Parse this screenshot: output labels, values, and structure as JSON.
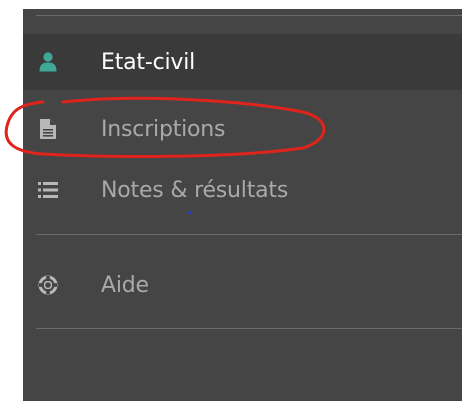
{
  "sidebar": {
    "items": [
      {
        "label": "Etat-civil",
        "icon": "user-icon",
        "active": true
      },
      {
        "label": "Inscriptions",
        "icon": "document-icon",
        "active": false
      },
      {
        "label": "Notes & résultats",
        "icon": "list-icon",
        "active": false
      },
      {
        "label": "Aide",
        "icon": "life-ring-icon",
        "active": false
      }
    ]
  },
  "colors": {
    "sidebar_bg": "#454545",
    "active_bg": "#3a3a3a",
    "active_icon": "#3fa796",
    "inactive_text": "#a9a9a9",
    "active_text": "#ffffff",
    "annotation": "#e0241b"
  }
}
